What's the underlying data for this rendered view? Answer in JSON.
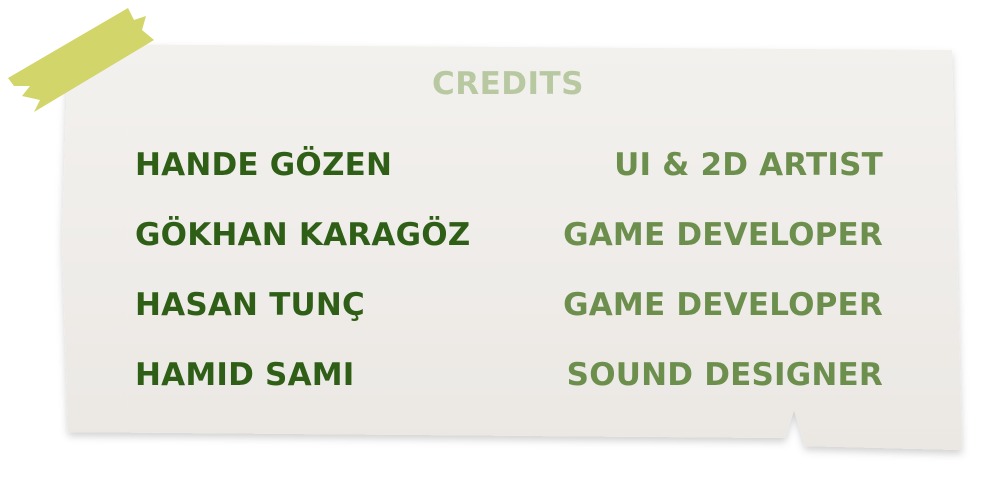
{
  "colors": {
    "card": "#efedea",
    "tape": "#d1d56a",
    "title": "#b8c9a2",
    "name": "#2f5f17",
    "role": "#6d8f4d"
  },
  "credits": {
    "title": "CREDITS",
    "rows": [
      {
        "name": "HANDE GÖZEN",
        "role": "UI & 2D ARTIST"
      },
      {
        "name": "GÖKHAN KARAGÖZ",
        "role": "GAME DEVELOPER"
      },
      {
        "name": "HASAN TUNÇ",
        "role": "GAME DEVELOPER"
      },
      {
        "name": "HAMID SAMI",
        "role": "SOUND DESIGNER"
      }
    ]
  },
  "decor": {
    "tape_icon": "masking-tape-icon",
    "card_shape": "torn-paper-card"
  }
}
